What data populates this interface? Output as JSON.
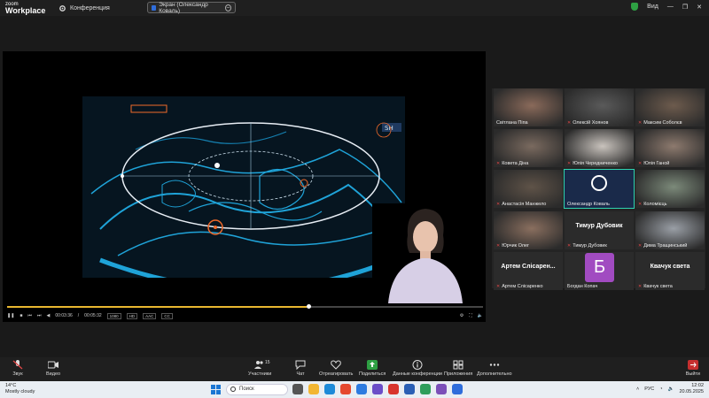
{
  "app": {
    "brand_small": "zoom",
    "brand": "Workplace"
  },
  "header": {
    "conference_label": "Конференция",
    "screen_share_label": "Экран (Олександр Коваль)",
    "view_label": "Вид"
  },
  "player": {
    "current_time": "00:03:36",
    "total_time": "00:05:32",
    "badges": [
      "1080",
      "HD",
      "AAC",
      "CC"
    ],
    "progress": 0.63
  },
  "gallery": {
    "tiles": [
      {
        "name": "Світлана Піпа",
        "muted": false,
        "kind": "cam",
        "color": "#8a6a5a"
      },
      {
        "name": "Олексій Хоянов",
        "muted": true,
        "kind": "cam",
        "color": "#5a5a5a"
      },
      {
        "name": "Максим Соболєв",
        "muted": true,
        "kind": "cam",
        "color": "#6d5b4d"
      },
      {
        "name": "Ковета Діна",
        "muted": true,
        "kind": "cam",
        "color": "#7a6a5f"
      },
      {
        "name": "Юлія Чередниченко",
        "muted": true,
        "kind": "cam",
        "color": "#c9c3bd"
      },
      {
        "name": "Юлія Ганой",
        "muted": true,
        "kind": "cam",
        "color": "#8d7a6e"
      },
      {
        "name": "Анастасія Манжело",
        "muted": true,
        "kind": "cam",
        "color": "#5f5348"
      },
      {
        "name": "Олександр Коваль",
        "muted": false,
        "kind": "obs",
        "color": "#1a2a4a"
      },
      {
        "name": "Коломієць",
        "muted": true,
        "kind": "cam",
        "color": "#7c8a7a"
      },
      {
        "name": "Юрчик Олег",
        "muted": true,
        "kind": "cam",
        "color": "#8a6f5f"
      },
      {
        "name": "Тимур Дубовик",
        "muted": true,
        "kind": "text",
        "big": "Тимур Дубовик"
      },
      {
        "name": "Дима Тращинський",
        "muted": true,
        "kind": "cam",
        "color": "#9a9fa6"
      },
      {
        "name": "Артем Слісаренко",
        "muted": true,
        "kind": "text",
        "big": "Артем Слісарен..."
      },
      {
        "name": "Богдан Копач",
        "muted": false,
        "kind": "avatar",
        "letter": "Б"
      },
      {
        "name": "Квачук света",
        "muted": true,
        "kind": "text",
        "big": "Квачук света"
      }
    ]
  },
  "toolbar": {
    "audio": "Звук",
    "video": "Видео",
    "participants": "Участники",
    "participants_count": "15",
    "chat": "Чат",
    "react": "Отреагировать",
    "share": "Поделиться",
    "conf_data": "Данные конференции",
    "apps": "Приложения",
    "more": "Дополнительно",
    "leave": "Выйти"
  },
  "taskbar": {
    "temp": "14°C",
    "weather": "Mostly cloudy",
    "search_placeholder": "Поиск",
    "lang": "РУС",
    "time": "12:02",
    "date": "20.05.2025"
  },
  "colors": {
    "accent": "#2fd4b0",
    "share_green": "#2ea043",
    "danger": "#e04646",
    "avatar": "#a14bc1"
  }
}
